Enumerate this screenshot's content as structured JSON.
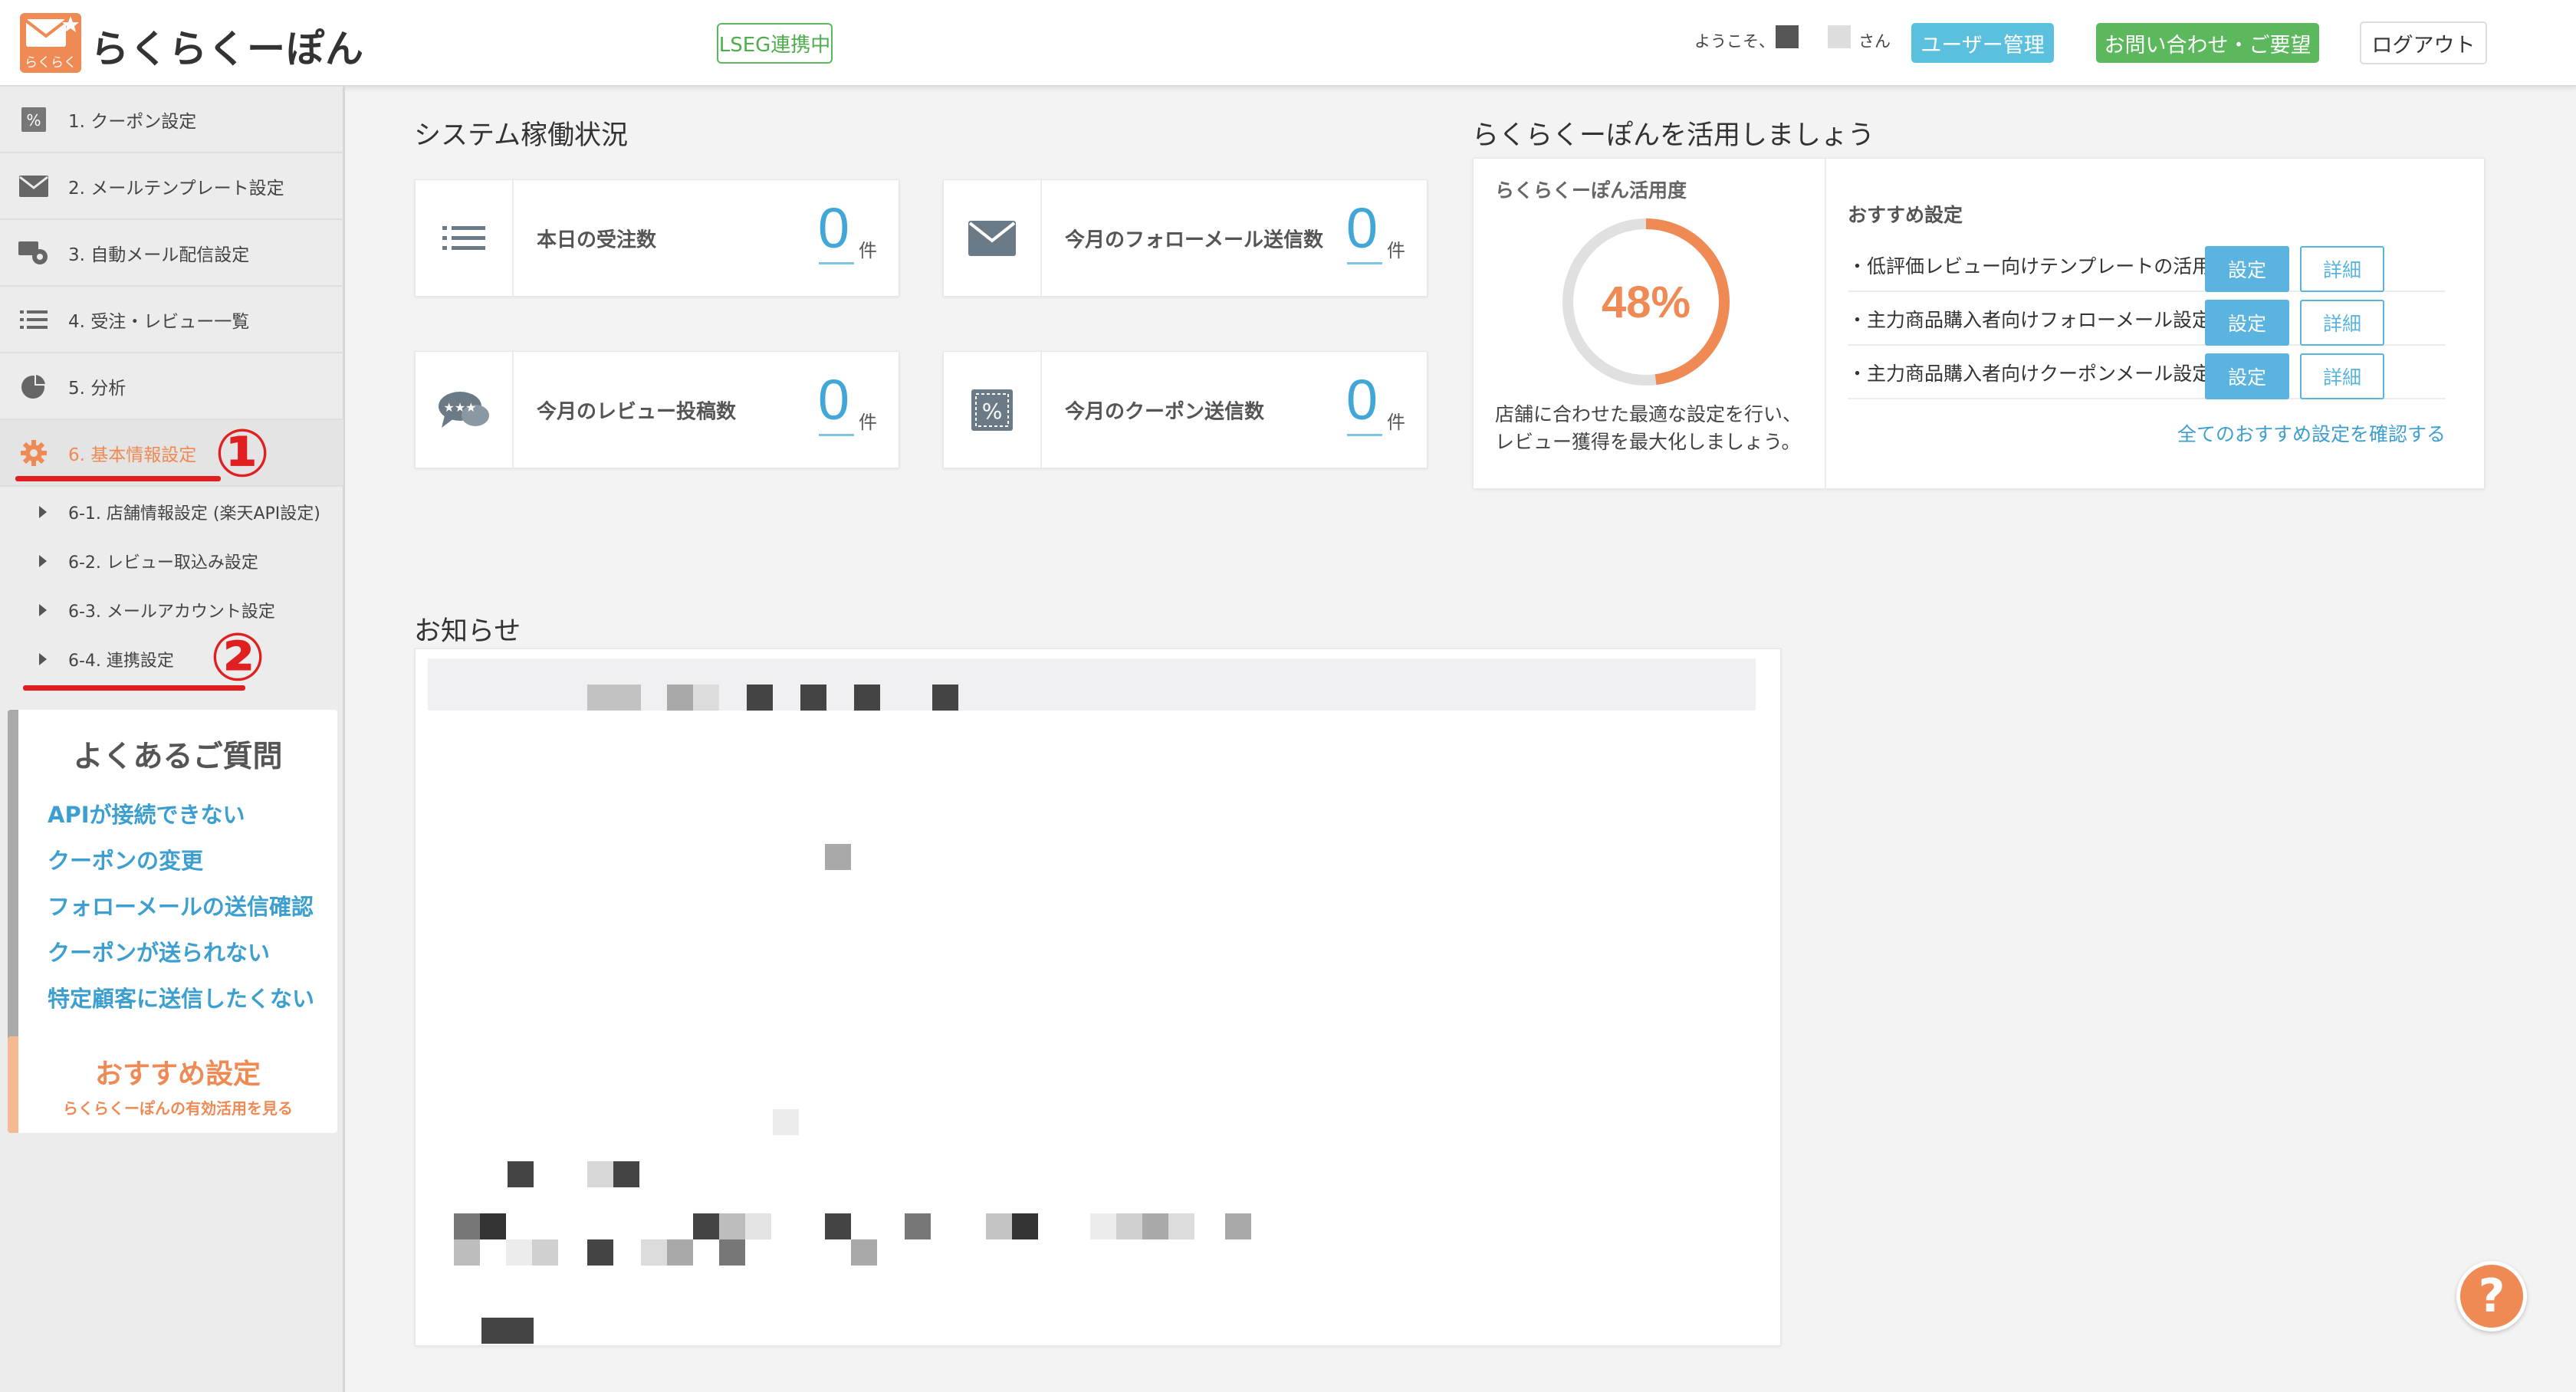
{
  "header": {
    "logo_badge": "らくらく",
    "logo_text": "らくらくーぽん",
    "lseg_badge": "LSEG連携中",
    "welcome_prefix": "ようこそ、",
    "welcome_suffix": "さん",
    "user_manage": "ユーザー管理",
    "contact": "お問い合わせ・ご要望",
    "logout": "ログアウト"
  },
  "sidebar": {
    "items": [
      {
        "label": "1. クーポン設定",
        "icon": "coupon-icon"
      },
      {
        "label": "2. メールテンプレート設定",
        "icon": "mail-icon"
      },
      {
        "label": "3. 自動メール配信設定",
        "icon": "mail-gear-icon"
      },
      {
        "label": "4. 受注・レビュー一覧",
        "icon": "list-icon"
      },
      {
        "label": "5. 分析",
        "icon": "pie-chart-icon"
      },
      {
        "label": "6. 基本情報設定",
        "icon": "gear-icon"
      }
    ],
    "subitems": [
      {
        "label": "6-1. 店舗情報設定 (楽天API設定)"
      },
      {
        "label": "6-2. レビュー取込み設定"
      },
      {
        "label": "6-3. メールアカウント設定"
      },
      {
        "label": "6-4. 連携設定"
      }
    ],
    "annotations": {
      "one": "①",
      "two": "②"
    },
    "faq": {
      "title": "よくあるご質問",
      "links": [
        "APIが接続できない",
        "クーポンの変更",
        "フォローメールの送信確認",
        "クーポンが送られない",
        "特定顧客に送信したくない"
      ]
    },
    "recommend_box": {
      "title": "おすすめ設定",
      "subtitle": "らくらくーぽんの有効活用を見る"
    }
  },
  "status": {
    "title": "システム稼働状況",
    "unit": "件",
    "cards": [
      {
        "label": "本日の受注数",
        "value": "0",
        "icon": "list-icon"
      },
      {
        "label": "今月のフォローメール送信数",
        "value": "0",
        "icon": "mail-icon"
      },
      {
        "label": "今月のレビュー投稿数",
        "value": "0",
        "icon": "review-bubble-icon"
      },
      {
        "label": "今月のクーポン送信数",
        "value": "0",
        "icon": "coupon-icon"
      }
    ]
  },
  "usage": {
    "title": "らくらくーぽんを活用しましょう",
    "rate_label": "らくらくーぽん活用度",
    "rate_value": "48%",
    "rate": 0.48,
    "desc_line1": "店舗に合わせた最適な設定を行い、",
    "desc_line2": "レビュー獲得を最大化しましょう。",
    "rec_title": "おすすめ設定",
    "rec_items": [
      {
        "label": "・低評価レビュー向けテンプレートの活用",
        "set": "設定",
        "detail": "詳細"
      },
      {
        "label": "・主力商品購入者向けフォローメール設定",
        "set": "設定",
        "detail": "詳細"
      },
      {
        "label": "・主力商品購入者向けクーポンメール設定",
        "set": "設定",
        "detail": "詳細"
      }
    ],
    "rec_all_link": "全てのおすすめ設定を確認する"
  },
  "news": {
    "title": "お知らせ"
  },
  "help": {
    "label": "?"
  },
  "colors": {
    "accent_orange": "#ef8a54",
    "accent_blue": "#42a7d6",
    "green": "#5cb85c",
    "annotation_red": "#e02020"
  }
}
